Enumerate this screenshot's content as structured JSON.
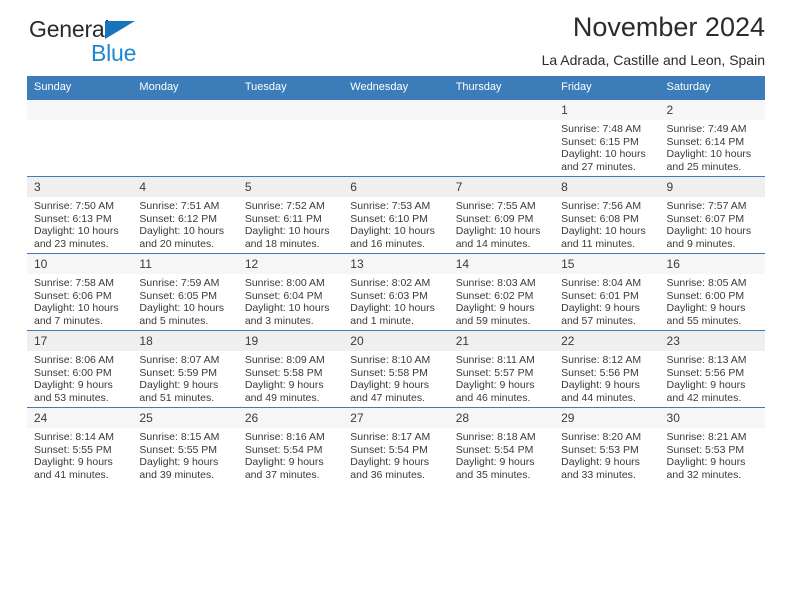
{
  "brand": {
    "word_one": "General",
    "word_two": "Blue",
    "triangle_color": "#1574bb",
    "blue_text_color": "#1f86d0"
  },
  "header": {
    "title": "November 2024",
    "subtitle": "La Adrada, Castille and Leon, Spain",
    "accent_color": "#3b7cb9",
    "daynum_band_color": "#efefef"
  },
  "weekday_headers": [
    "Sunday",
    "Monday",
    "Tuesday",
    "Wednesday",
    "Thursday",
    "Friday",
    "Saturday"
  ],
  "weeks": [
    [
      {
        "day": "",
        "sunrise": "",
        "sunset": "",
        "daylight": "",
        "empty": true
      },
      {
        "day": "",
        "sunrise": "",
        "sunset": "",
        "daylight": "",
        "empty": true
      },
      {
        "day": "",
        "sunrise": "",
        "sunset": "",
        "daylight": "",
        "empty": true
      },
      {
        "day": "",
        "sunrise": "",
        "sunset": "",
        "daylight": "",
        "empty": true
      },
      {
        "day": "",
        "sunrise": "",
        "sunset": "",
        "daylight": "",
        "empty": true
      },
      {
        "day": "1",
        "sunrise": "Sunrise: 7:48 AM",
        "sunset": "Sunset: 6:15 PM",
        "daylight": "Daylight: 10 hours and 27 minutes."
      },
      {
        "day": "2",
        "sunrise": "Sunrise: 7:49 AM",
        "sunset": "Sunset: 6:14 PM",
        "daylight": "Daylight: 10 hours and 25 minutes."
      }
    ],
    [
      {
        "day": "3",
        "sunrise": "Sunrise: 7:50 AM",
        "sunset": "Sunset: 6:13 PM",
        "daylight": "Daylight: 10 hours and 23 minutes."
      },
      {
        "day": "4",
        "sunrise": "Sunrise: 7:51 AM",
        "sunset": "Sunset: 6:12 PM",
        "daylight": "Daylight: 10 hours and 20 minutes."
      },
      {
        "day": "5",
        "sunrise": "Sunrise: 7:52 AM",
        "sunset": "Sunset: 6:11 PM",
        "daylight": "Daylight: 10 hours and 18 minutes."
      },
      {
        "day": "6",
        "sunrise": "Sunrise: 7:53 AM",
        "sunset": "Sunset: 6:10 PM",
        "daylight": "Daylight: 10 hours and 16 minutes."
      },
      {
        "day": "7",
        "sunrise": "Sunrise: 7:55 AM",
        "sunset": "Sunset: 6:09 PM",
        "daylight": "Daylight: 10 hours and 14 minutes."
      },
      {
        "day": "8",
        "sunrise": "Sunrise: 7:56 AM",
        "sunset": "Sunset: 6:08 PM",
        "daylight": "Daylight: 10 hours and 11 minutes."
      },
      {
        "day": "9",
        "sunrise": "Sunrise: 7:57 AM",
        "sunset": "Sunset: 6:07 PM",
        "daylight": "Daylight: 10 hours and 9 minutes."
      }
    ],
    [
      {
        "day": "10",
        "sunrise": "Sunrise: 7:58 AM",
        "sunset": "Sunset: 6:06 PM",
        "daylight": "Daylight: 10 hours and 7 minutes."
      },
      {
        "day": "11",
        "sunrise": "Sunrise: 7:59 AM",
        "sunset": "Sunset: 6:05 PM",
        "daylight": "Daylight: 10 hours and 5 minutes."
      },
      {
        "day": "12",
        "sunrise": "Sunrise: 8:00 AM",
        "sunset": "Sunset: 6:04 PM",
        "daylight": "Daylight: 10 hours and 3 minutes."
      },
      {
        "day": "13",
        "sunrise": "Sunrise: 8:02 AM",
        "sunset": "Sunset: 6:03 PM",
        "daylight": "Daylight: 10 hours and 1 minute."
      },
      {
        "day": "14",
        "sunrise": "Sunrise: 8:03 AM",
        "sunset": "Sunset: 6:02 PM",
        "daylight": "Daylight: 9 hours and 59 minutes."
      },
      {
        "day": "15",
        "sunrise": "Sunrise: 8:04 AM",
        "sunset": "Sunset: 6:01 PM",
        "daylight": "Daylight: 9 hours and 57 minutes."
      },
      {
        "day": "16",
        "sunrise": "Sunrise: 8:05 AM",
        "sunset": "Sunset: 6:00 PM",
        "daylight": "Daylight: 9 hours and 55 minutes."
      }
    ],
    [
      {
        "day": "17",
        "sunrise": "Sunrise: 8:06 AM",
        "sunset": "Sunset: 6:00 PM",
        "daylight": "Daylight: 9 hours and 53 minutes."
      },
      {
        "day": "18",
        "sunrise": "Sunrise: 8:07 AM",
        "sunset": "Sunset: 5:59 PM",
        "daylight": "Daylight: 9 hours and 51 minutes."
      },
      {
        "day": "19",
        "sunrise": "Sunrise: 8:09 AM",
        "sunset": "Sunset: 5:58 PM",
        "daylight": "Daylight: 9 hours and 49 minutes."
      },
      {
        "day": "20",
        "sunrise": "Sunrise: 8:10 AM",
        "sunset": "Sunset: 5:58 PM",
        "daylight": "Daylight: 9 hours and 47 minutes."
      },
      {
        "day": "21",
        "sunrise": "Sunrise: 8:11 AM",
        "sunset": "Sunset: 5:57 PM",
        "daylight": "Daylight: 9 hours and 46 minutes."
      },
      {
        "day": "22",
        "sunrise": "Sunrise: 8:12 AM",
        "sunset": "Sunset: 5:56 PM",
        "daylight": "Daylight: 9 hours and 44 minutes."
      },
      {
        "day": "23",
        "sunrise": "Sunrise: 8:13 AM",
        "sunset": "Sunset: 5:56 PM",
        "daylight": "Daylight: 9 hours and 42 minutes."
      }
    ],
    [
      {
        "day": "24",
        "sunrise": "Sunrise: 8:14 AM",
        "sunset": "Sunset: 5:55 PM",
        "daylight": "Daylight: 9 hours and 41 minutes."
      },
      {
        "day": "25",
        "sunrise": "Sunrise: 8:15 AM",
        "sunset": "Sunset: 5:55 PM",
        "daylight": "Daylight: 9 hours and 39 minutes."
      },
      {
        "day": "26",
        "sunrise": "Sunrise: 8:16 AM",
        "sunset": "Sunset: 5:54 PM",
        "daylight": "Daylight: 9 hours and 37 minutes."
      },
      {
        "day": "27",
        "sunrise": "Sunrise: 8:17 AM",
        "sunset": "Sunset: 5:54 PM",
        "daylight": "Daylight: 9 hours and 36 minutes."
      },
      {
        "day": "28",
        "sunrise": "Sunrise: 8:18 AM",
        "sunset": "Sunset: 5:54 PM",
        "daylight": "Daylight: 9 hours and 35 minutes."
      },
      {
        "day": "29",
        "sunrise": "Sunrise: 8:20 AM",
        "sunset": "Sunset: 5:53 PM",
        "daylight": "Daylight: 9 hours and 33 minutes."
      },
      {
        "day": "30",
        "sunrise": "Sunrise: 8:21 AM",
        "sunset": "Sunset: 5:53 PM",
        "daylight": "Daylight: 9 hours and 32 minutes."
      }
    ]
  ]
}
